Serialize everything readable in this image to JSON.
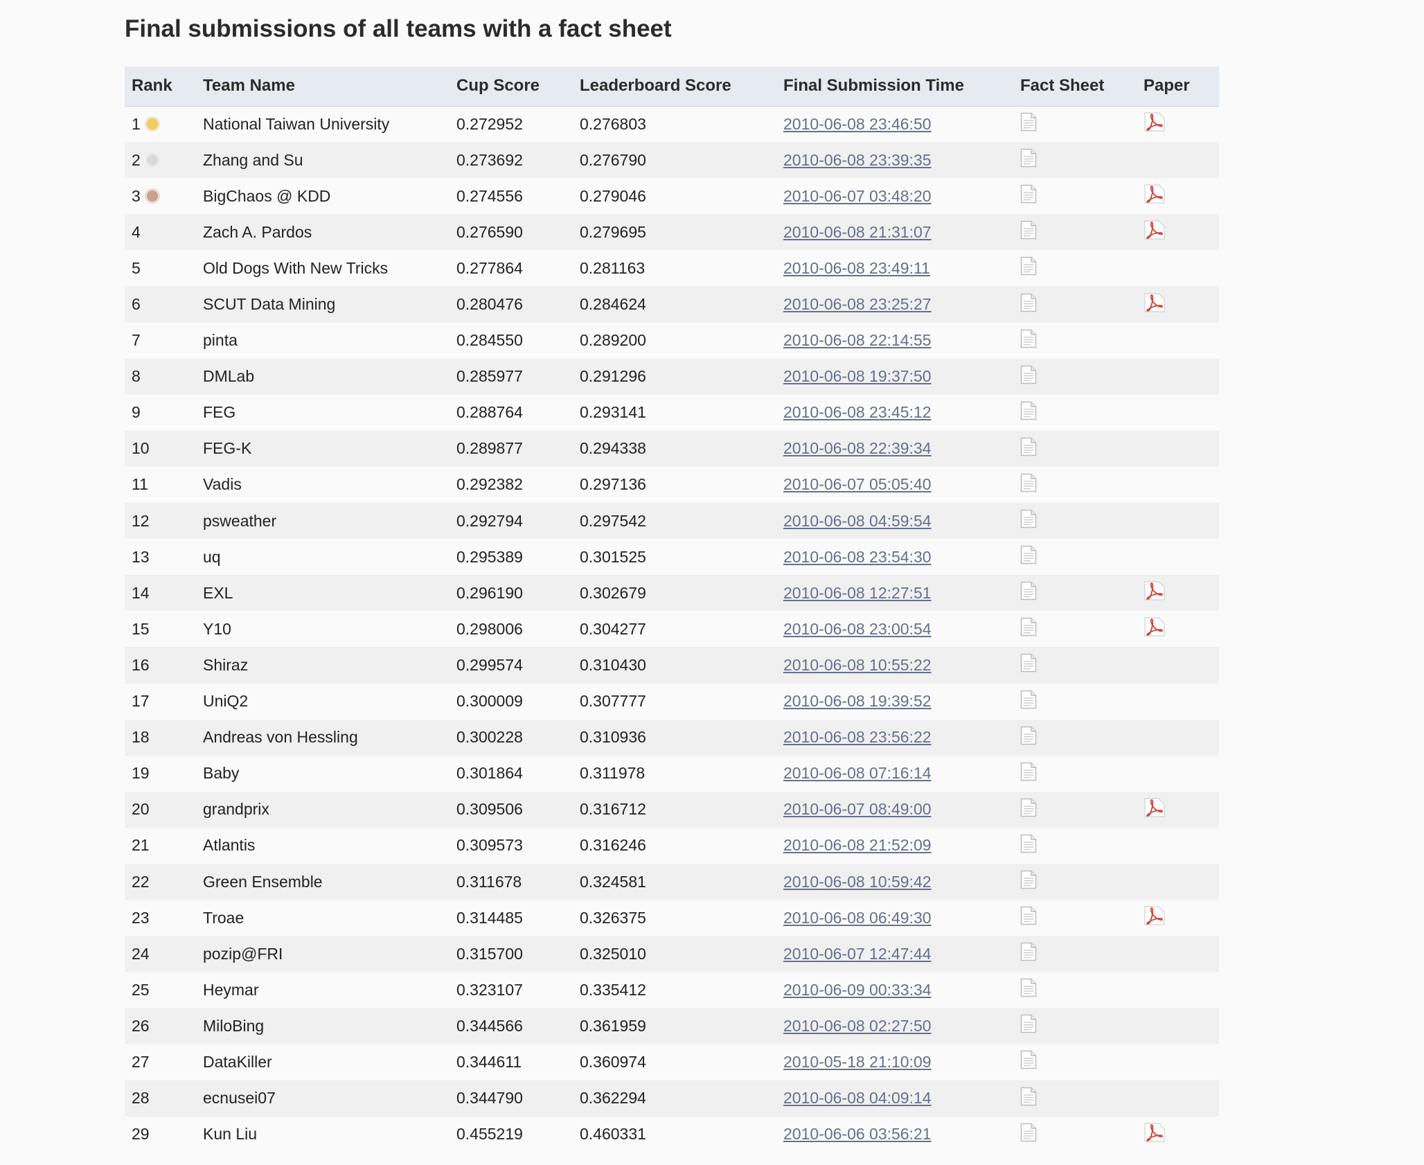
{
  "page_title": "Final submissions of all teams with a fact sheet",
  "columns": [
    "Rank",
    "Team Name",
    "Cup Score",
    "Leaderboard Score",
    "Final Submission Time",
    "Fact Sheet",
    "Paper"
  ],
  "colors": {
    "link": "#66708c",
    "header_bg": "#e6ebf2",
    "pdf_red": "#d0403a",
    "gold": "#f2cc5e",
    "silver": "#dadada",
    "bronze": "#c9a28d"
  },
  "rows": [
    {
      "rank": "1",
      "medal": "gold",
      "team": "National Taiwan University",
      "cup": "0.272952",
      "lb": "0.276803",
      "time": "2010-06-08 23:46:50",
      "paper": true
    },
    {
      "rank": "2",
      "medal": "silver",
      "team": "Zhang and Su",
      "cup": "0.273692",
      "lb": "0.276790",
      "time": "2010-06-08 23:39:35",
      "paper": false
    },
    {
      "rank": "3",
      "medal": "bronze",
      "team": "BigChaos @ KDD",
      "cup": "0.274556",
      "lb": "0.279046",
      "time": "2010-06-07 03:48:20",
      "paper": true
    },
    {
      "rank": "4",
      "medal": "",
      "team": "Zach A. Pardos",
      "cup": "0.276590",
      "lb": "0.279695",
      "time": "2010-06-08 21:31:07",
      "paper": true
    },
    {
      "rank": "5",
      "medal": "",
      "team": "Old Dogs With New Tricks",
      "cup": "0.277864",
      "lb": "0.281163",
      "time": "2010-06-08 23:49:11",
      "paper": false
    },
    {
      "rank": "6",
      "medal": "",
      "team": "SCUT Data Mining",
      "cup": "0.280476",
      "lb": "0.284624",
      "time": "2010-06-08 23:25:27",
      "paper": true
    },
    {
      "rank": "7",
      "medal": "",
      "team": "pinta",
      "cup": "0.284550",
      "lb": "0.289200",
      "time": "2010-06-08 22:14:55",
      "paper": false
    },
    {
      "rank": "8",
      "medal": "",
      "team": "DMLab",
      "cup": "0.285977",
      "lb": "0.291296",
      "time": "2010-06-08 19:37:50",
      "paper": false
    },
    {
      "rank": "9",
      "medal": "",
      "team": "FEG",
      "cup": "0.288764",
      "lb": "0.293141",
      "time": "2010-06-08 23:45:12",
      "paper": false
    },
    {
      "rank": "10",
      "medal": "",
      "team": "FEG-K",
      "cup": "0.289877",
      "lb": "0.294338",
      "time": "2010-06-08 22:39:34",
      "paper": false
    },
    {
      "rank": "11",
      "medal": "",
      "team": "Vadis",
      "cup": "0.292382",
      "lb": "0.297136",
      "time": "2010-06-07 05:05:40",
      "paper": false
    },
    {
      "rank": "12",
      "medal": "",
      "team": "psweather",
      "cup": "0.292794",
      "lb": "0.297542",
      "time": "2010-06-08 04:59:54",
      "paper": false
    },
    {
      "rank": "13",
      "medal": "",
      "team": "uq",
      "cup": "0.295389",
      "lb": "0.301525",
      "time": "2010-06-08 23:54:30",
      "paper": false
    },
    {
      "rank": "14",
      "medal": "",
      "team": "EXL",
      "cup": "0.296190",
      "lb": "0.302679",
      "time": "2010-06-08 12:27:51",
      "paper": true
    },
    {
      "rank": "15",
      "medal": "",
      "team": "Y10",
      "cup": "0.298006",
      "lb": "0.304277",
      "time": "2010-06-08 23:00:54",
      "paper": true
    },
    {
      "rank": "16",
      "medal": "",
      "team": "Shiraz",
      "cup": "0.299574",
      "lb": "0.310430",
      "time": "2010-06-08 10:55:22",
      "paper": false
    },
    {
      "rank": "17",
      "medal": "",
      "team": "UniQ2",
      "cup": "0.300009",
      "lb": "0.307777",
      "time": "2010-06-08 19:39:52",
      "paper": false
    },
    {
      "rank": "18",
      "medal": "",
      "team": "Andreas von Hessling",
      "cup": "0.300228",
      "lb": "0.310936",
      "time": "2010-06-08 23:56:22",
      "paper": false
    },
    {
      "rank": "19",
      "medal": "",
      "team": "Baby",
      "cup": "0.301864",
      "lb": "0.311978",
      "time": "2010-06-08 07:16:14",
      "paper": false
    },
    {
      "rank": "20",
      "medal": "",
      "team": "grandprix",
      "cup": "0.309506",
      "lb": "0.316712",
      "time": "2010-06-07 08:49:00",
      "paper": true
    },
    {
      "rank": "21",
      "medal": "",
      "team": "Atlantis",
      "cup": "0.309573",
      "lb": "0.316246",
      "time": "2010-06-08 21:52:09",
      "paper": false
    },
    {
      "rank": "22",
      "medal": "",
      "team": "Green Ensemble",
      "cup": "0.311678",
      "lb": "0.324581",
      "time": "2010-06-08 10:59:42",
      "paper": false
    },
    {
      "rank": "23",
      "medal": "",
      "team": "Troae",
      "cup": "0.314485",
      "lb": "0.326375",
      "time": "2010-06-08 06:49:30",
      "paper": true
    },
    {
      "rank": "24",
      "medal": "",
      "team": "pozip@FRI",
      "cup": "0.315700",
      "lb": "0.325010",
      "time": "2010-06-07 12:47:44",
      "paper": false
    },
    {
      "rank": "25",
      "medal": "",
      "team": "Heymar",
      "cup": "0.323107",
      "lb": "0.335412",
      "time": "2010-06-09 00:33:34",
      "paper": false
    },
    {
      "rank": "26",
      "medal": "",
      "team": "MiloBing",
      "cup": "0.344566",
      "lb": "0.361959",
      "time": "2010-06-08 02:27:50",
      "paper": false
    },
    {
      "rank": "27",
      "medal": "",
      "team": "DataKiller",
      "cup": "0.344611",
      "lb": "0.360974",
      "time": "2010-05-18 21:10:09",
      "paper": false
    },
    {
      "rank": "28",
      "medal": "",
      "team": "ecnusei07",
      "cup": "0.344790",
      "lb": "0.362294",
      "time": "2010-06-08 04:09:14",
      "paper": false
    },
    {
      "rank": "29",
      "medal": "",
      "team": "Kun Liu",
      "cup": "0.455219",
      "lb": "0.460331",
      "time": "2010-06-06 03:56:21",
      "paper": true
    }
  ]
}
